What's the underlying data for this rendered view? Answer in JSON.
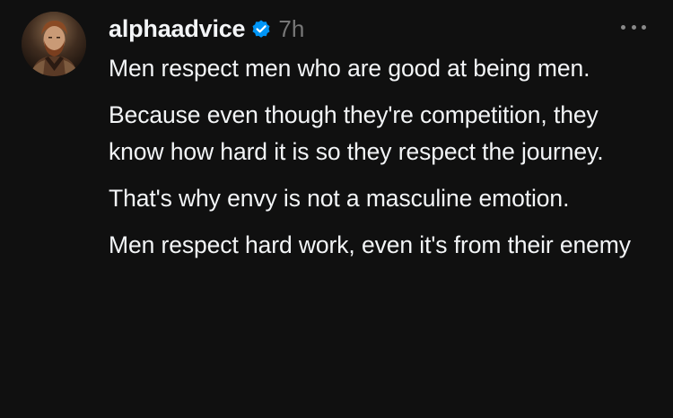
{
  "post": {
    "username": "alphaadvice",
    "timestamp": "7h",
    "verified": true,
    "avatar_icon": "avatar-icon",
    "more_icon": "more-options-icon",
    "paragraphs": [
      "Men respect men who are good at being men.",
      "Because even though they're competition, they know how hard it is so they respect the journey.",
      "That's why envy is not a masculine emotion.",
      "Men respect hard work, even it's from their enemy"
    ]
  },
  "colors": {
    "background": "#101010",
    "text": "#f3f5f7",
    "muted": "#777777",
    "verified_badge": "#0095f6"
  }
}
